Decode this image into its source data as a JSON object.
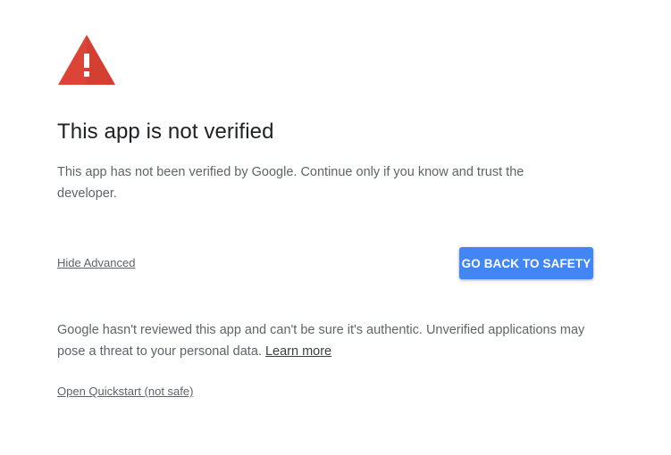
{
  "warning": {
    "icon": "warning-triangle-icon",
    "color": "#db4437"
  },
  "title": "This app is not verified",
  "description": "This app has not been verified by Google. Continue only if you know and trust the developer.",
  "hide_advanced_label": "Hide Advanced",
  "back_button_label": "GO BACK TO SAFETY",
  "advanced": {
    "text": "Google hasn't reviewed this app and can't be sure it's authentic. Unverified applications may pose a threat to your personal data.",
    "learn_more_label": "Learn more"
  },
  "open_link_label": "Open Quickstart (not safe)",
  "colors": {
    "primary_button": "#4285f4",
    "text": "#5f6368",
    "title": "#202124"
  }
}
